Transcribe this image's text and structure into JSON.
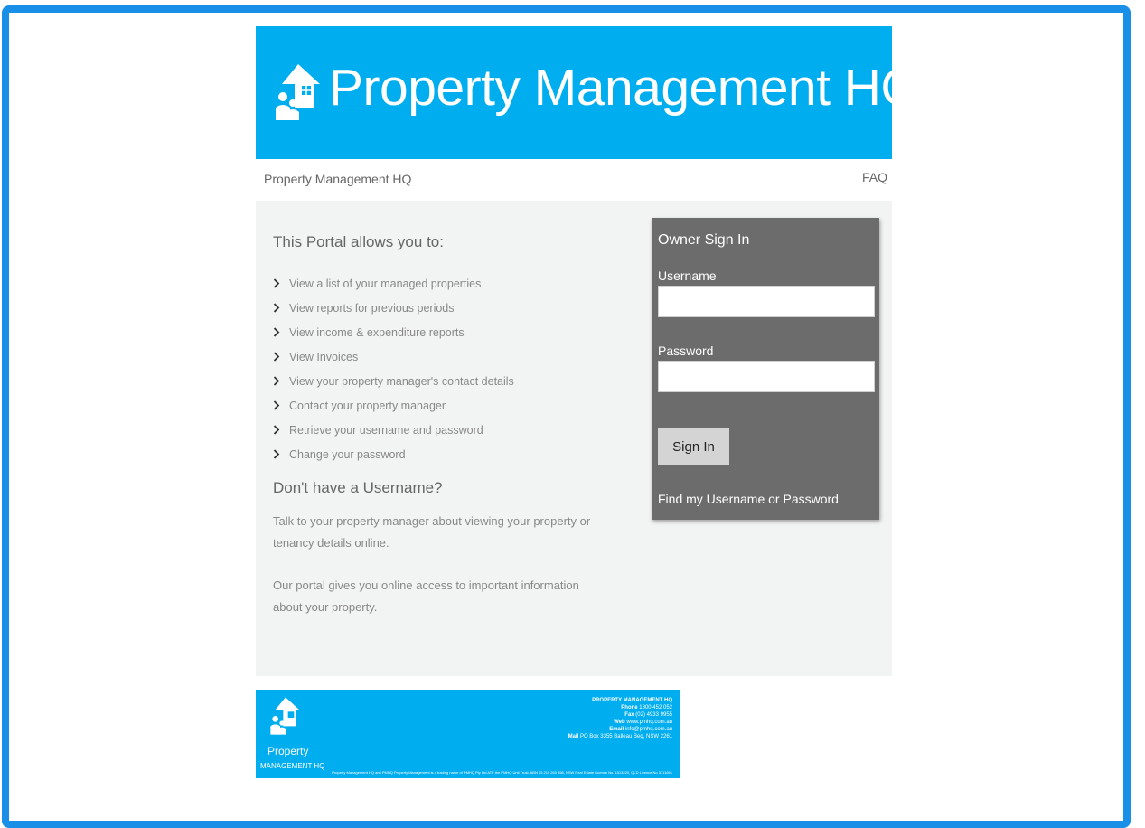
{
  "banner": {
    "title": "Property Management HQ"
  },
  "nav": {
    "home": "Property Management HQ",
    "faq": "FAQ"
  },
  "intro": {
    "heading": "This Portal allows you to:",
    "features": [
      "View a list of your managed properties",
      "View reports for previous periods",
      "View income & expenditure reports",
      "View Invoices",
      "View your property manager's contact details",
      "Contact your property manager",
      "Retrieve your username and password",
      "Change your password"
    ],
    "no_user_heading": "Don't have a Username?",
    "para1": "Talk to your property manager about viewing your property or tenancy details online.",
    "para2": "Our portal gives you online access to important information about your property."
  },
  "signin": {
    "title": "Owner Sign In",
    "username_label": "Username",
    "username_value": "",
    "password_label": "Password",
    "password_value": "",
    "button": "Sign In",
    "forgot_link": "Find my Username or Password"
  },
  "footer": {
    "brand_line1": "Property",
    "brand_line2": "MANAGEMENT HQ",
    "company": "PROPERTY MANAGEMENT HQ",
    "phone_label": "Phone",
    "phone": "1800 452 052",
    "fax_label": "Fax",
    "fax": "(02) 4933 9955",
    "web_label": "Web",
    "web": "www.pmhq.com.au",
    "email_label": "Email",
    "email": "info@pmhq.com.au",
    "mail_label": "Mail",
    "mail": "PO Box 3355 Balleau Beg, NSW 2261",
    "legal": "Property Management HQ and PMHQ Property Management is a trading name of PMHQ Pty Ltd ATF the PMHQ Unit Trust, ABN 55 219 260 356, NSW Real Estate Licence No. 1513220, QLD Licence No 3711691"
  },
  "colors": {
    "frame": "#1a8fe8",
    "brand": "#00adef",
    "panel": "#6c6c6c",
    "content_bg": "#f2f3f3"
  },
  "icons": {
    "logo": "house-family-icon",
    "bullet": "chevron-right-icon"
  }
}
